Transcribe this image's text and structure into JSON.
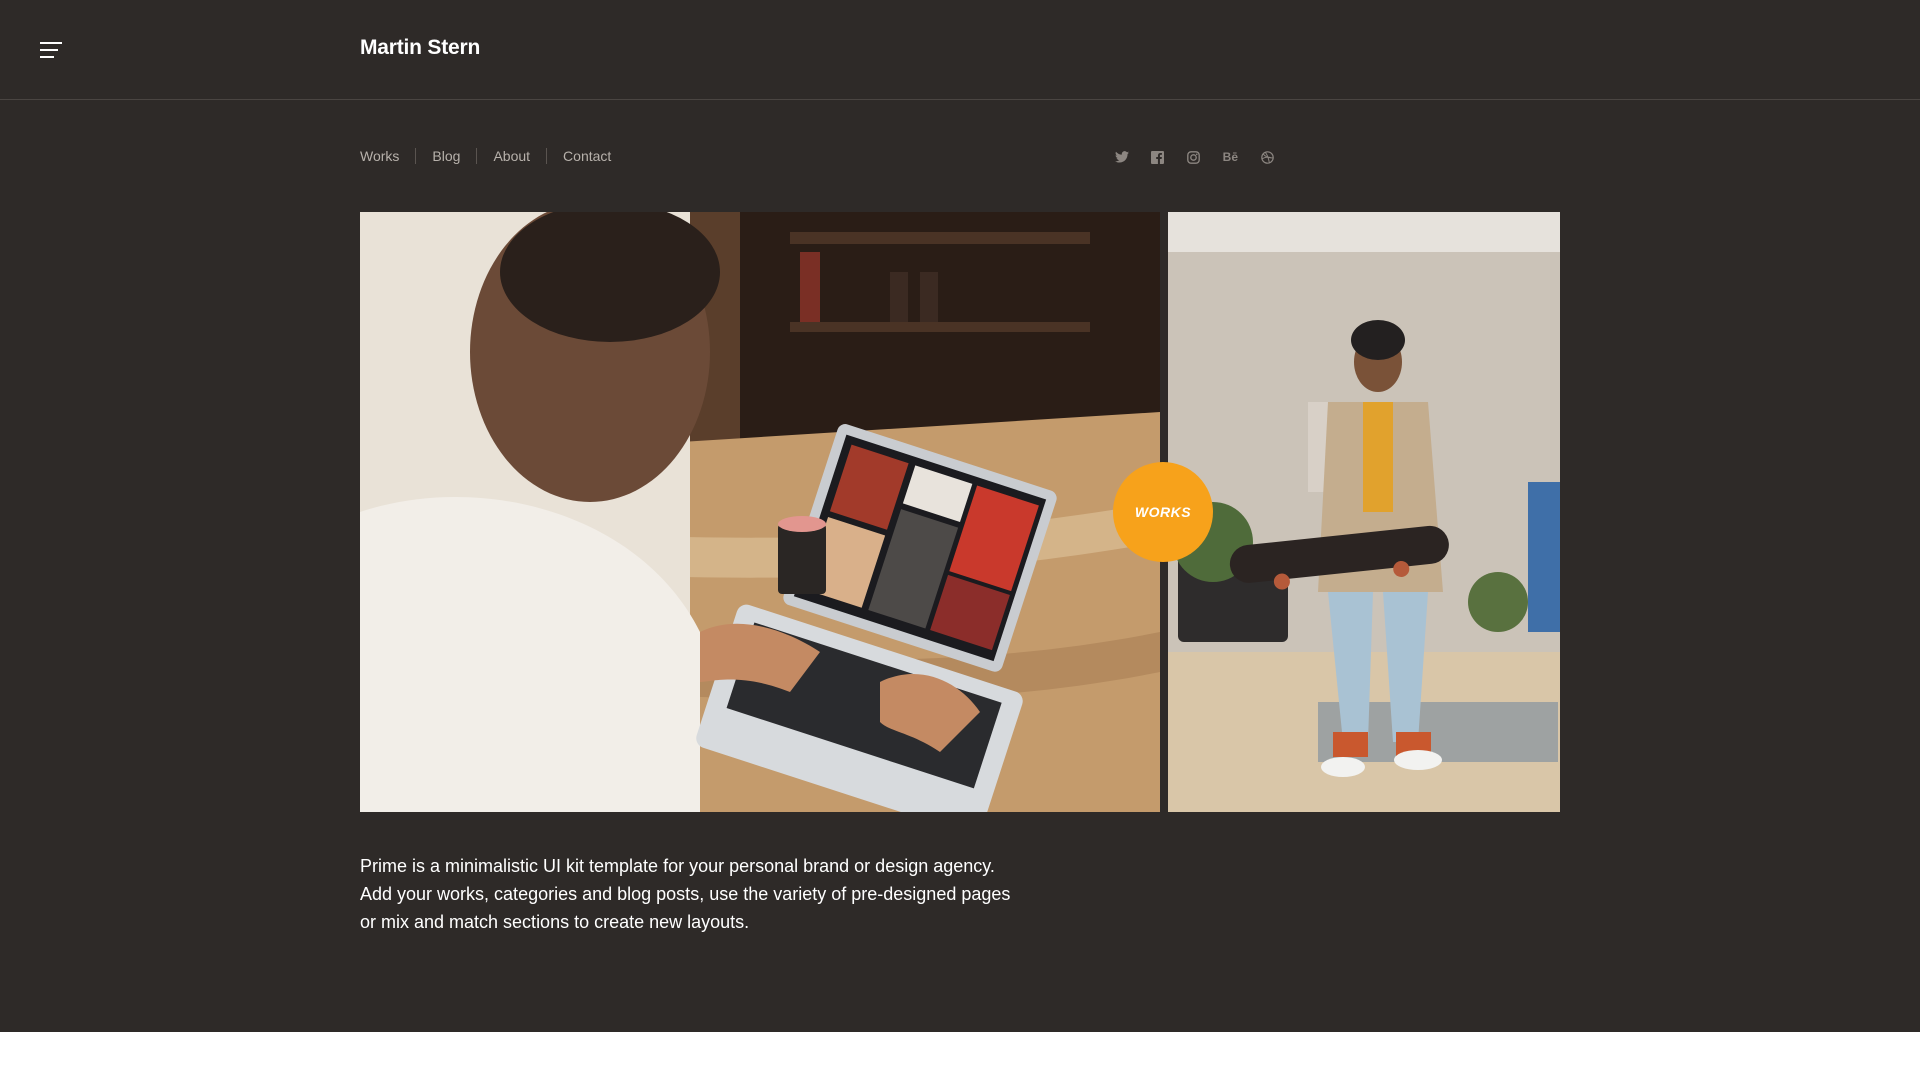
{
  "header": {
    "brand": "Martin Stern",
    "menu_icon": "hamburger-menu-icon"
  },
  "nav": {
    "items": [
      {
        "label": "Works"
      },
      {
        "label": "Blog"
      },
      {
        "label": "About"
      },
      {
        "label": "Contact"
      }
    ]
  },
  "social": {
    "items": [
      {
        "icon": "twitter-icon"
      },
      {
        "icon": "facebook-icon"
      },
      {
        "icon": "instagram-icon"
      },
      {
        "icon": "behance-icon",
        "label": "Bē"
      },
      {
        "icon": "dribbble-icon"
      }
    ]
  },
  "hero": {
    "badge_label": "WORKS",
    "badge_color": "#f7a21b"
  },
  "intro": {
    "line1": "Prime is a minimalistic UI kit template for your personal brand or design agency.",
    "line2": "Add your works, categories and blog posts, use the variety of pre-designed pages",
    "line3": "or mix and match sections to create new layouts."
  },
  "colors": {
    "background": "#2e2a28",
    "accent": "#f7a21b",
    "text": "#ffffff",
    "muted": "#b7b1ab"
  }
}
